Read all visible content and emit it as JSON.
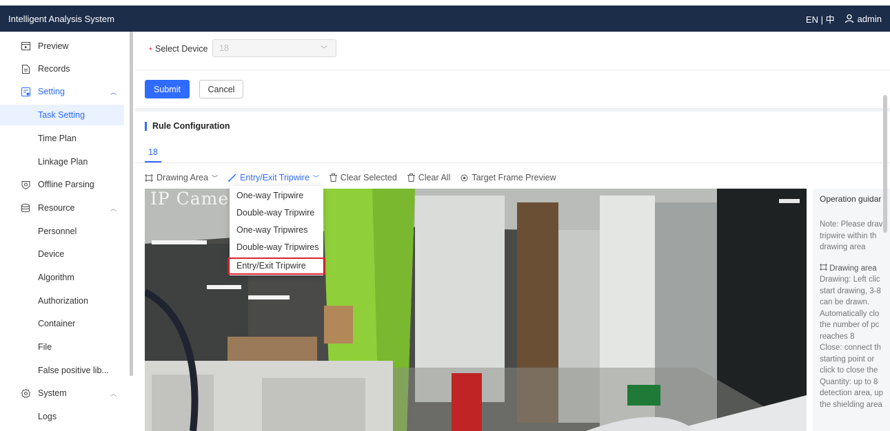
{
  "app": {
    "title": "Intelligent Analysis System",
    "lang": "EN | 中",
    "user": "admin"
  },
  "sidebar": {
    "items": [
      {
        "label": "Preview",
        "icon": "preview-icon"
      },
      {
        "label": "Records",
        "icon": "records-icon"
      },
      {
        "label": "Setting",
        "icon": "setting-icon",
        "expanded": true
      },
      {
        "label": "Task Setting",
        "selected": true
      },
      {
        "label": "Time Plan"
      },
      {
        "label": "Linkage Plan"
      },
      {
        "label": "Offline Parsing",
        "icon": "offline-parsing-icon"
      },
      {
        "label": "Resource",
        "icon": "resource-icon",
        "expanded": true
      },
      {
        "label": "Personnel"
      },
      {
        "label": "Device"
      },
      {
        "label": "Algorithm"
      },
      {
        "label": "Authorization"
      },
      {
        "label": "Container"
      },
      {
        "label": "File"
      },
      {
        "label": "False positive lib..."
      },
      {
        "label": "System",
        "icon": "system-icon",
        "expanded": true
      },
      {
        "label": "Logs"
      }
    ]
  },
  "form": {
    "required_mark": "*",
    "device_label": "Select Device",
    "device_value": "18",
    "submit_label": "Submit",
    "cancel_label": "Cancel"
  },
  "rule": {
    "title": "Rule Configuration",
    "tab": "18",
    "toolbar": {
      "drawing_area": "Drawing Area",
      "entry_exit": "Entry/Exit Tripwire",
      "clear_selected": "Clear Selected",
      "clear_all": "Clear All",
      "target_preview": "Target Frame Preview"
    },
    "dropdown": [
      "One-way Tripwire",
      "Double-way Tripwire",
      "One-way Tripwires",
      "Double-way Tripwires",
      "Entry/Exit Tripwire"
    ],
    "dropdown_selected": "Entry/Exit Tripwire",
    "video_overlay": "IP Came"
  },
  "guide": {
    "title": "Operation guidar",
    "lines": [
      "Note: Please drav",
      "tripwire within th",
      "drawing area"
    ],
    "section_title": "Drawing area",
    "section_lines": [
      "Drawing: Left clic",
      "start drawing, 3-8",
      "can be drawn.",
      "Automatically clo",
      "the number of pc",
      "reaches 8",
      "Close: connect th",
      "starting point or",
      "click to close the",
      "Quantity: up to 8",
      "detection area, up",
      "the shielding area"
    ]
  },
  "colors": {
    "topbar": "#1c2d4a",
    "accent": "#2f6bff",
    "highlight": "#d9232d"
  }
}
